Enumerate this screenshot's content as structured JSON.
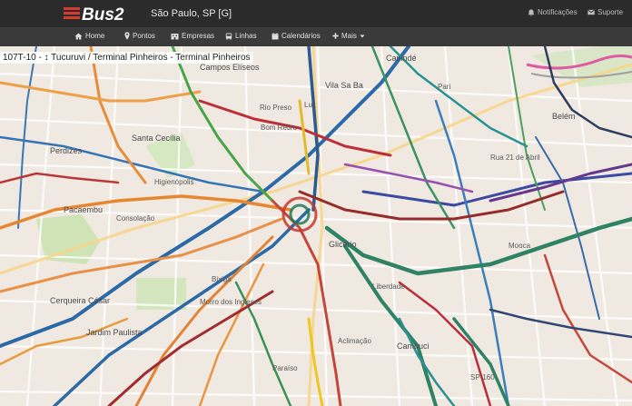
{
  "header": {
    "logo_text": "Bus2",
    "city": "São Paulo, SP [G]",
    "notifications_label": "Notificações",
    "support_label": "Suporte"
  },
  "nav": {
    "items": [
      {
        "label": "Home",
        "icon": "home-icon"
      },
      {
        "label": "Pontos",
        "icon": "map-pin-icon"
      },
      {
        "label": "Empresas",
        "icon": "building-icon"
      },
      {
        "label": "Linhas",
        "icon": "bus-icon"
      },
      {
        "label": "Calendários",
        "icon": "calendar-icon"
      },
      {
        "label": "Mais",
        "icon": "plus-icon"
      }
    ]
  },
  "route": {
    "label": "107T-10 - ↕ Tucuruvi / Terminal Pinheiros - Terminal Pinheiros"
  },
  "map_labels": [
    "Campos Elíseos",
    "Santa Cecília",
    "Perdizes",
    "Pacaembu",
    "Consolação",
    "Bixiga",
    "Morro dos Ingleses",
    "Cerqueira César",
    "Jardim Paulista",
    "Cambuci",
    "Aclimação",
    "Glicério",
    "Vila Sa Ba",
    "Canindé",
    "Belém",
    "Higienópolis",
    "Bom Retiro",
    "Luz",
    "Pari",
    "Liberdade",
    "Rua 21 de Abril",
    "Rio Preso",
    "Paraíso",
    "Mooca",
    "SP-160"
  ],
  "colors": {
    "header_bg": "#2b2b2b",
    "nav_bg": "#3a3a3a",
    "logo_red": "#d73b2f",
    "map_bg": "#efe9e1"
  }
}
